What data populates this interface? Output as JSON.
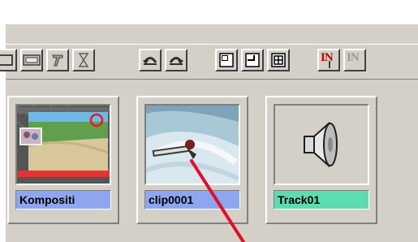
{
  "colors": {
    "window_bg": "#d4d0c8",
    "label_selected_blue": "#8ea6f0",
    "label_audio_green": "#5cdcb0",
    "annotation_arrow": "#e0102a"
  },
  "toolbar": {
    "buttons": [
      {
        "icon": "film-frame-icon"
      },
      {
        "icon": "film-strip-icon"
      },
      {
        "icon": "text-title-icon"
      },
      {
        "icon": "hourglass-icon"
      },
      {
        "icon": "undo-icon"
      },
      {
        "icon": "redo-icon"
      },
      {
        "icon": "window-corner-top-left-icon"
      },
      {
        "icon": "window-corner-bottom-left-icon"
      },
      {
        "icon": "window-grid-icon"
      },
      {
        "icon": "mark-in-icon",
        "text": "IN"
      },
      {
        "icon": "mark-out-icon",
        "text": "IN"
      }
    ]
  },
  "clips": [
    {
      "label": "Kompositi­",
      "type": "composition",
      "label_color": "#8ea6f0"
    },
    {
      "label": "clip0001",
      "type": "video",
      "label_color": "#8ea6f0"
    },
    {
      "label": "Track01",
      "type": "audio",
      "label_color": "#5cdcb0"
    }
  ]
}
